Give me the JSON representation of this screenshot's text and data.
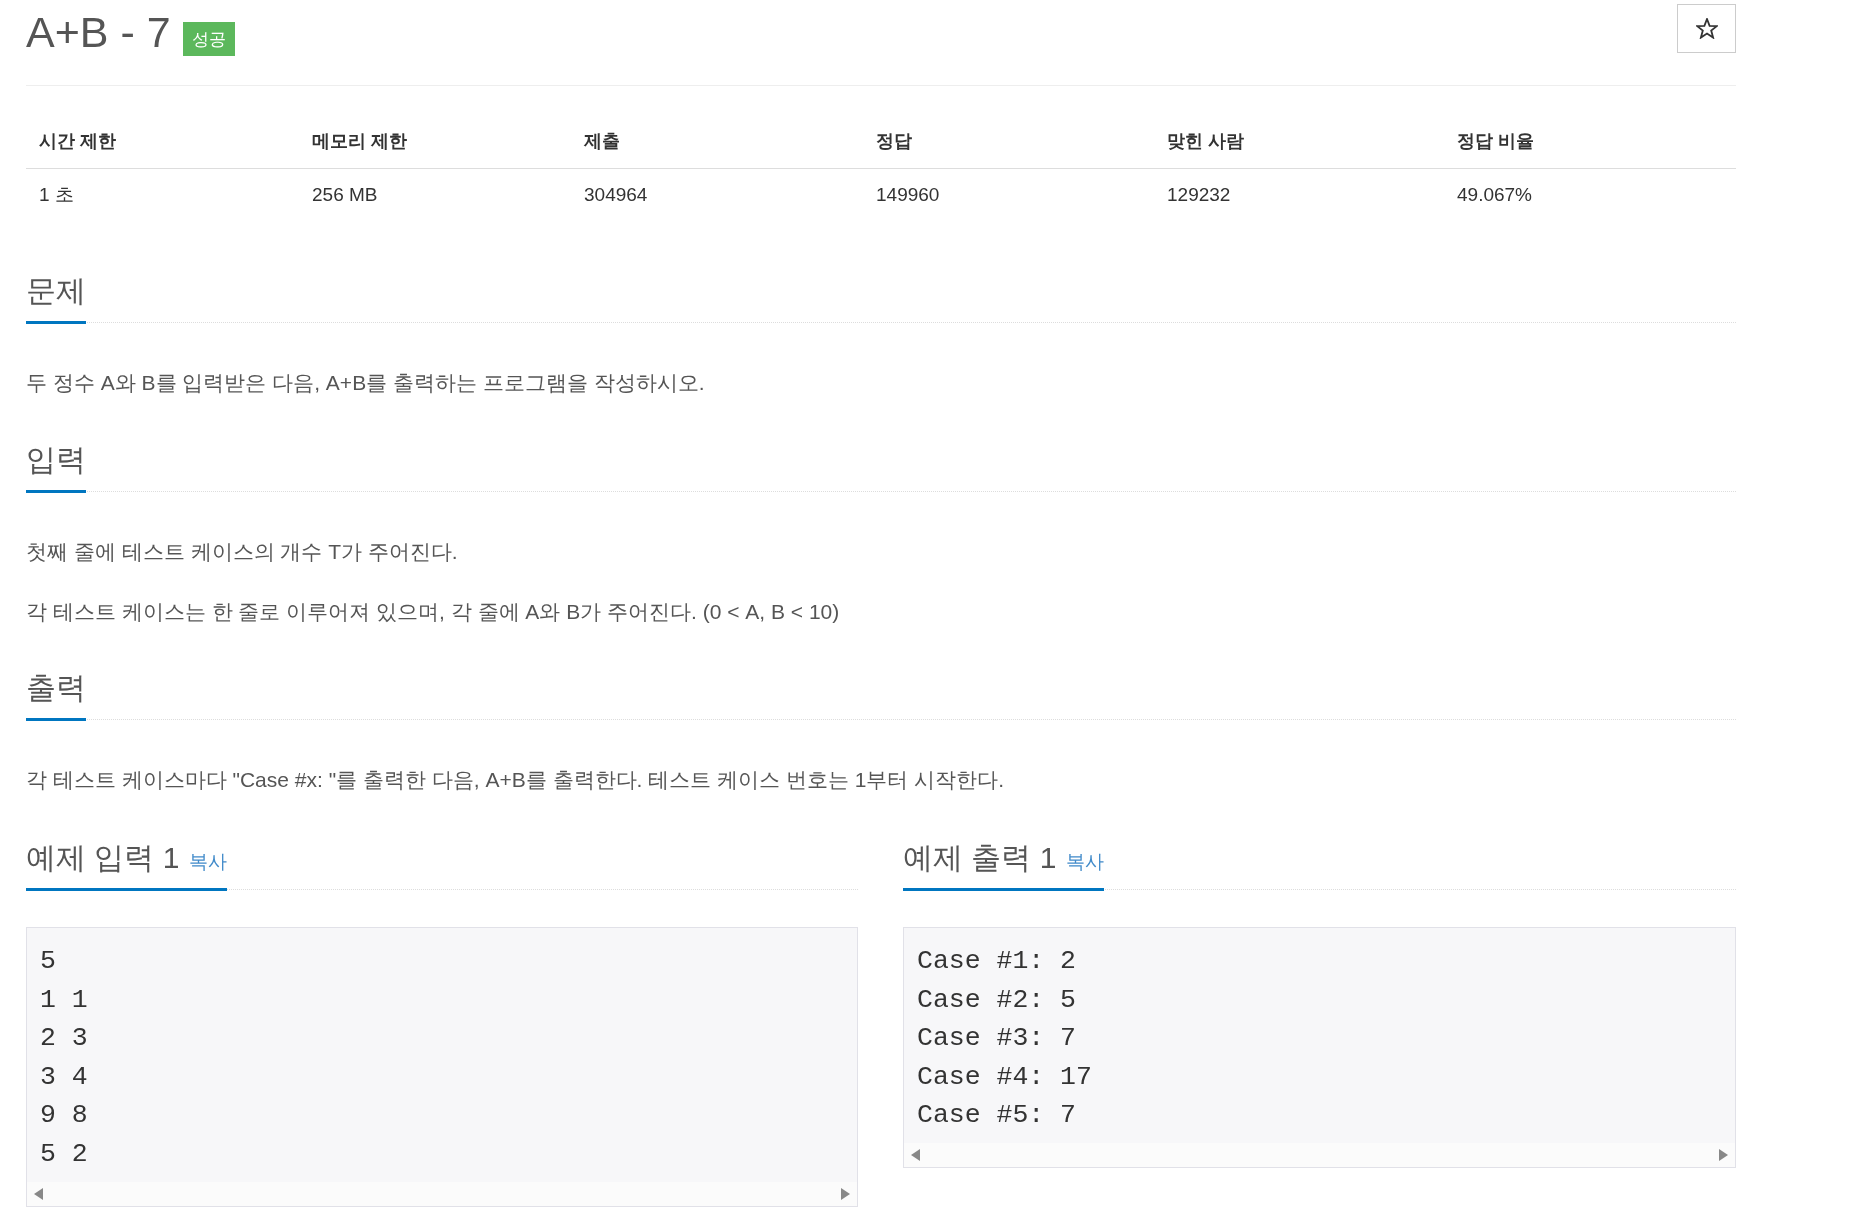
{
  "problem": {
    "title": "A+B - 7",
    "result_badge": "성공",
    "starred": false
  },
  "stats": {
    "columns": [
      "시간 제한",
      "메모리 제한",
      "제출",
      "정답",
      "맞힌 사람",
      "정답 비율"
    ],
    "row": [
      "1 초",
      "256 MB",
      "304964",
      "149960",
      "129232",
      "49.067%"
    ]
  },
  "sections": [
    {
      "heading": "문제",
      "paragraphs": [
        "두 정수 A와 B를 입력받은 다음, A+B를 출력하는 프로그램을 작성하시오."
      ]
    },
    {
      "heading": "입력",
      "paragraphs": [
        "첫째 줄에 테스트 케이스의 개수 T가 주어진다.",
        "각 테스트 케이스는 한 줄로 이루어져 있으며, 각 줄에 A와 B가 주어진다. (0 < A, B < 10)"
      ]
    },
    {
      "heading": "출력",
      "paragraphs": [
        "각 테스트 케이스마다 \"Case #x: \"를 출력한 다음, A+B를 출력한다. 테스트 케이스 번호는 1부터 시작한다."
      ]
    }
  ],
  "samples": [
    {
      "heading": "예제 입력 1",
      "copy_label": "복사",
      "lines": [
        "5",
        "1 1",
        "2 3",
        "3 4",
        "9 8",
        "5 2"
      ]
    },
    {
      "heading": "예제 출력 1",
      "copy_label": "복사",
      "lines": [
        "Case #1: 2",
        "Case #2: 5",
        "Case #3: 7",
        "Case #4: 17",
        "Case #5: 7"
      ]
    }
  ]
}
